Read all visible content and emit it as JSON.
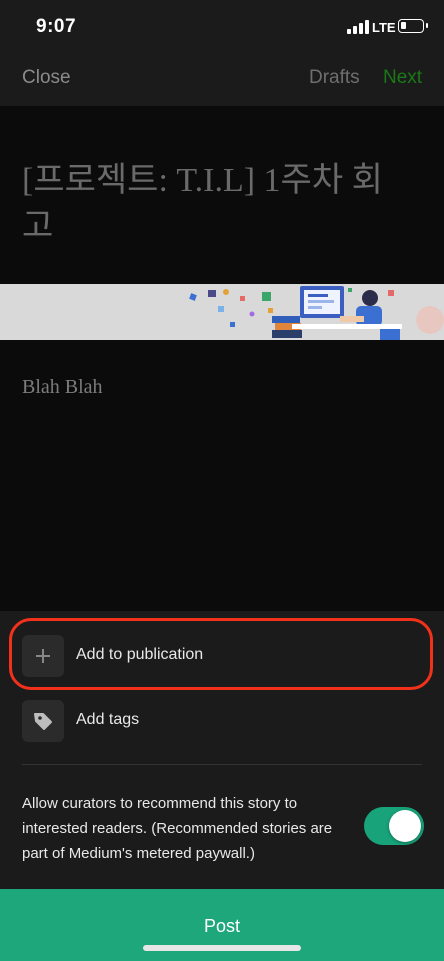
{
  "status_bar": {
    "time": "9:07",
    "network": "LTE",
    "battery_level": 0.25
  },
  "nav": {
    "close_label": "Close",
    "drafts_label": "Drafts",
    "next_label": "Next",
    "next_color": "#1a8917"
  },
  "editor": {
    "title": "[프로젝트: T.I.L] 1주차 회고",
    "body": "Blah Blah",
    "cover_image_icon": "desk-illustration-icon"
  },
  "sheet": {
    "add_to_publication_label": "Add to publication",
    "add_tags_label": "Add tags",
    "curate_text": "Allow curators to recommend this story to interested readers. (Recommended stories are part of Medium's metered paywall.)",
    "curate_toggle_on": true,
    "toggle_color": "#18a37a",
    "highlight_color": "#f2311b"
  },
  "post": {
    "label": "Post",
    "color": "#1fa77c"
  }
}
